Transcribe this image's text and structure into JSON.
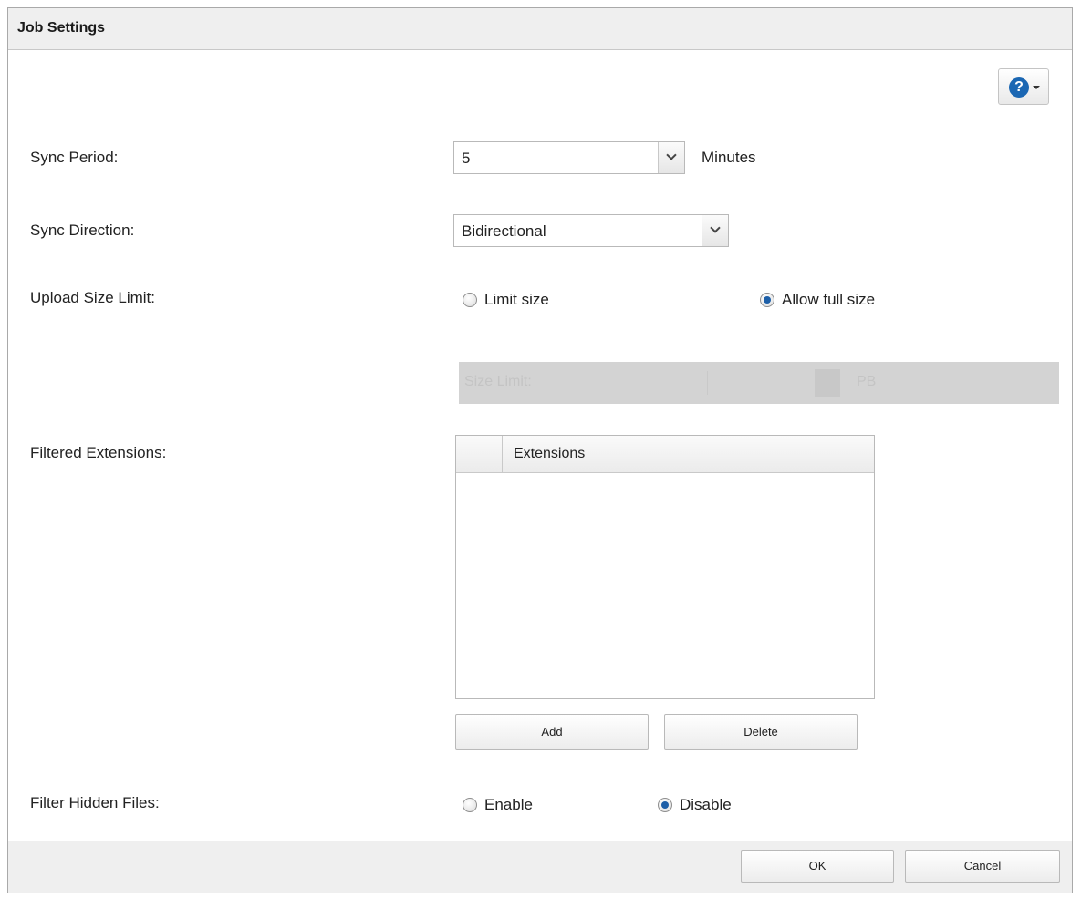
{
  "dialog": {
    "title": "Job Settings",
    "help_icon": "help-icon"
  },
  "sync_period": {
    "label": "Sync Period:",
    "value": "5",
    "unit": "Minutes"
  },
  "sync_direction": {
    "label": "Sync Direction:",
    "value": "Bidirectional"
  },
  "upload_size_limit": {
    "label": "Upload Size Limit:",
    "options": [
      {
        "label": "Limit size",
        "checked": false
      },
      {
        "label": "Allow full size",
        "checked": true
      }
    ],
    "disabled_row": {
      "label": "Size Limit:",
      "unit": "PB"
    }
  },
  "filtered_extensions": {
    "label": "Filtered Extensions:",
    "column_header": "Extensions",
    "rows": [],
    "add_label": "Add",
    "delete_label": "Delete"
  },
  "filter_hidden_files": {
    "label": "Filter Hidden Files:",
    "options": [
      {
        "label": "Enable",
        "checked": false
      },
      {
        "label": "Disable",
        "checked": true
      }
    ]
  },
  "footer": {
    "ok_label": "OK",
    "cancel_label": "Cancel"
  },
  "colors": {
    "accent": "#1d5fa8",
    "help_icon_bg": "#1b67b3"
  }
}
